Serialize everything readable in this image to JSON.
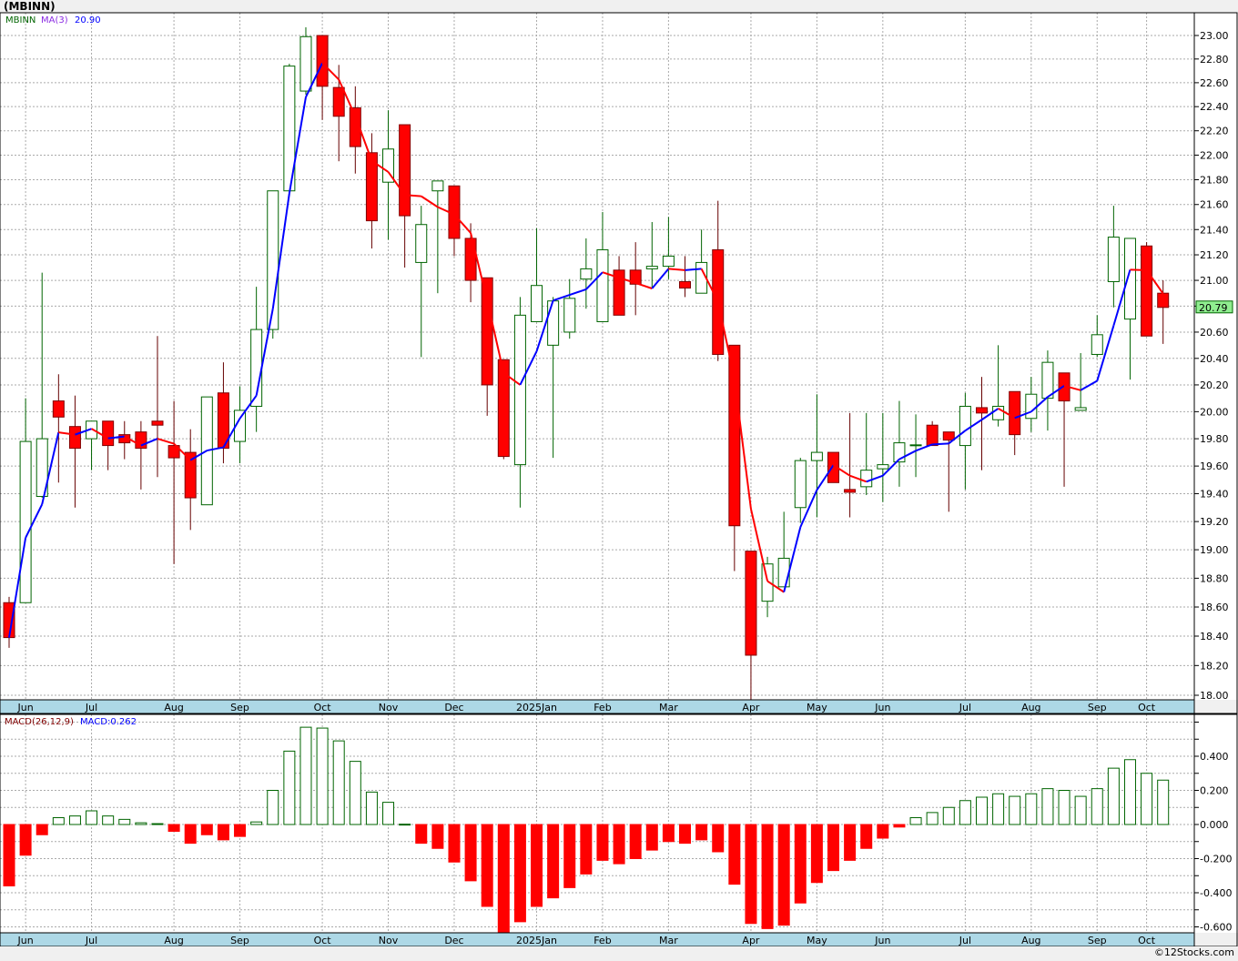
{
  "title": "(MBINN)",
  "copyright": "©12Stocks.com",
  "chart_data": [
    {
      "type": "candlestick",
      "symbol_label": "MBINN",
      "indicator_label": "MA(3)",
      "indicator_value": "20.90",
      "last_price_label": "20.79",
      "scale": "log",
      "ylim": [
        18.0,
        23.0
      ],
      "grid": true,
      "y_ticks": [
        "23.00",
        "22.80",
        "22.60",
        "22.40",
        "22.20",
        "22.00",
        "21.80",
        "21.60",
        "21.40",
        "21.20",
        "21.00",
        "20.80",
        "20.60",
        "20.40",
        "20.20",
        "20.00",
        "19.80",
        "19.60",
        "19.40",
        "19.20",
        "19.00",
        "18.80",
        "18.60",
        "18.40",
        "18.20",
        "18.00"
      ],
      "x_ticks": [
        {
          "label": "Jun",
          "index": 1
        },
        {
          "label": "Jul",
          "index": 5
        },
        {
          "label": "Aug",
          "index": 10
        },
        {
          "label": "Sep",
          "index": 14
        },
        {
          "label": "Oct",
          "index": 19
        },
        {
          "label": "Nov",
          "index": 23
        },
        {
          "label": "Dec",
          "index": 27
        },
        {
          "label": "2025Jan",
          "index": 32
        },
        {
          "label": "Feb",
          "index": 36
        },
        {
          "label": "Mar",
          "index": 40
        },
        {
          "label": "Apr",
          "index": 45
        },
        {
          "label": "May",
          "index": 49
        },
        {
          "label": "Jun",
          "index": 53
        },
        {
          "label": "Jul",
          "index": 58
        },
        {
          "label": "Aug",
          "index": 62
        },
        {
          "label": "Sep",
          "index": 66
        },
        {
          "label": "Oct",
          "index": 69
        }
      ],
      "colors": {
        "up": "#006400",
        "down": "#ff0000",
        "ma_up": "#0000ff",
        "ma_down": "#ff0000",
        "label_bg": "#90ee90"
      },
      "ohlc": [
        [
          18.63,
          18.67,
          18.32,
          18.39
        ],
        [
          18.63,
          20.1,
          18.63,
          19.78
        ],
        [
          19.38,
          21.06,
          19.37,
          19.8
        ],
        [
          20.08,
          20.28,
          19.48,
          19.96
        ],
        [
          19.89,
          20.12,
          19.3,
          19.73
        ],
        [
          19.8,
          19.93,
          19.57,
          19.93
        ],
        [
          19.93,
          19.93,
          19.57,
          19.75
        ],
        [
          19.83,
          19.93,
          19.65,
          19.77
        ],
        [
          19.85,
          19.93,
          19.43,
          19.73
        ],
        [
          19.93,
          20.57,
          19.52,
          19.9
        ],
        [
          19.75,
          20.08,
          18.9,
          19.66
        ],
        [
          19.7,
          19.87,
          19.14,
          19.37
        ],
        [
          19.32,
          20.11,
          19.32,
          20.11
        ],
        [
          20.14,
          20.37,
          19.62,
          19.73
        ],
        [
          19.78,
          20.19,
          19.62,
          20.01
        ],
        [
          20.04,
          20.95,
          19.85,
          20.62
        ],
        [
          20.62,
          21.71,
          20.55,
          21.71
        ],
        [
          21.71,
          22.76,
          21.71,
          22.74
        ],
        [
          22.53,
          23.07,
          22.5,
          22.99
        ],
        [
          23.0,
          23.0,
          22.29,
          22.57
        ],
        [
          22.56,
          22.75,
          21.95,
          22.32
        ],
        [
          22.39,
          22.57,
          21.85,
          22.07
        ],
        [
          22.02,
          22.18,
          21.25,
          21.47
        ],
        [
          21.78,
          22.37,
          21.32,
          22.05
        ],
        [
          22.25,
          22.25,
          21.1,
          21.51
        ],
        [
          21.14,
          21.59,
          20.41,
          21.44
        ],
        [
          21.71,
          21.79,
          20.9,
          21.79
        ],
        [
          21.75,
          21.75,
          21.19,
          21.33
        ],
        [
          21.33,
          21.45,
          20.83,
          21.0
        ],
        [
          21.02,
          21.02,
          19.97,
          20.2
        ],
        [
          20.39,
          20.39,
          19.65,
          19.67
        ],
        [
          19.61,
          20.87,
          19.3,
          20.73
        ],
        [
          20.68,
          21.41,
          20.68,
          20.96
        ],
        [
          20.5,
          20.87,
          19.66,
          20.84
        ],
        [
          20.6,
          21.01,
          20.55,
          20.86
        ],
        [
          21.01,
          21.33,
          20.78,
          21.09
        ],
        [
          20.68,
          21.54,
          20.68,
          21.24
        ],
        [
          21.08,
          21.19,
          20.73,
          20.73
        ],
        [
          21.08,
          21.3,
          20.73,
          20.97
        ],
        [
          21.09,
          21.46,
          20.94,
          21.11
        ],
        [
          21.11,
          21.5,
          21.01,
          21.19
        ],
        [
          20.99,
          21.19,
          20.87,
          20.94
        ],
        [
          20.9,
          21.4,
          20.9,
          21.14
        ],
        [
          21.24,
          21.63,
          20.38,
          20.43
        ],
        [
          20.5,
          20.5,
          18.85,
          19.17
        ],
        [
          18.99,
          18.99,
          17.96,
          18.27
        ],
        [
          18.64,
          18.95,
          18.53,
          18.9
        ],
        [
          18.74,
          19.27,
          18.74,
          18.94
        ],
        [
          19.3,
          19.66,
          19.19,
          19.64
        ],
        [
          19.64,
          20.13,
          19.23,
          19.7
        ],
        [
          19.7,
          19.7,
          19.48,
          19.48
        ],
        [
          19.43,
          19.99,
          19.23,
          19.41
        ],
        [
          19.45,
          19.99,
          19.39,
          19.57
        ],
        [
          19.58,
          19.99,
          19.34,
          19.61
        ],
        [
          19.63,
          20.08,
          19.45,
          19.77
        ],
        [
          19.75,
          19.98,
          19.52,
          19.755
        ],
        [
          19.9,
          19.93,
          19.75,
          19.75
        ],
        [
          19.85,
          19.85,
          19.27,
          19.79
        ],
        [
          19.75,
          20.14,
          19.43,
          20.04
        ],
        [
          20.03,
          20.26,
          19.57,
          19.99
        ],
        [
          19.94,
          20.5,
          19.89,
          20.04
        ],
        [
          20.15,
          20.15,
          19.68,
          19.83
        ],
        [
          19.95,
          20.26,
          19.85,
          20.13
        ],
        [
          20.1,
          20.46,
          19.86,
          20.37
        ],
        [
          20.29,
          20.29,
          19.45,
          20.08
        ],
        [
          20.01,
          20.44,
          20.01,
          20.03
        ],
        [
          20.43,
          20.73,
          20.41,
          20.58
        ],
        [
          20.99,
          21.59,
          20.79,
          21.34
        ],
        [
          20.7,
          21.33,
          20.24,
          21.33
        ],
        [
          21.27,
          21.3,
          20.57,
          20.57
        ],
        [
          20.9,
          21.0,
          20.51,
          20.79
        ]
      ]
    },
    {
      "type": "bar",
      "indicator_label": "MACD(26,12,9)",
      "value_label": "MACD:0.262",
      "ylim": [
        -0.63,
        0.63
      ],
      "grid": true,
      "y_ticks": [
        "0.400",
        "0.200",
        "0.000",
        "-0.200",
        "-0.400",
        "-0.600"
      ],
      "colors": {
        "positive": "#006400",
        "negative": "#ff0000"
      },
      "values": [
        -0.36,
        -0.18,
        -0.06,
        0.04,
        0.05,
        0.08,
        0.05,
        0.03,
        0.01,
        0.005,
        -0.04,
        -0.11,
        -0.06,
        -0.09,
        -0.07,
        0.015,
        0.2,
        0.43,
        0.57,
        0.565,
        0.49,
        0.37,
        0.19,
        0.13,
        0.002,
        -0.11,
        -0.14,
        -0.22,
        -0.33,
        -0.48,
        -0.63,
        -0.57,
        -0.48,
        -0.43,
        -0.37,
        -0.29,
        -0.21,
        -0.23,
        -0.2,
        -0.15,
        -0.1,
        -0.11,
        -0.09,
        -0.16,
        -0.35,
        -0.58,
        -0.61,
        -0.59,
        -0.46,
        -0.34,
        -0.27,
        -0.21,
        -0.14,
        -0.08,
        -0.015,
        0.04,
        0.07,
        0.1,
        0.14,
        0.16,
        0.18,
        0.165,
        0.18,
        0.21,
        0.2,
        0.165,
        0.21,
        0.33,
        0.38,
        0.3,
        0.26
      ]
    }
  ]
}
